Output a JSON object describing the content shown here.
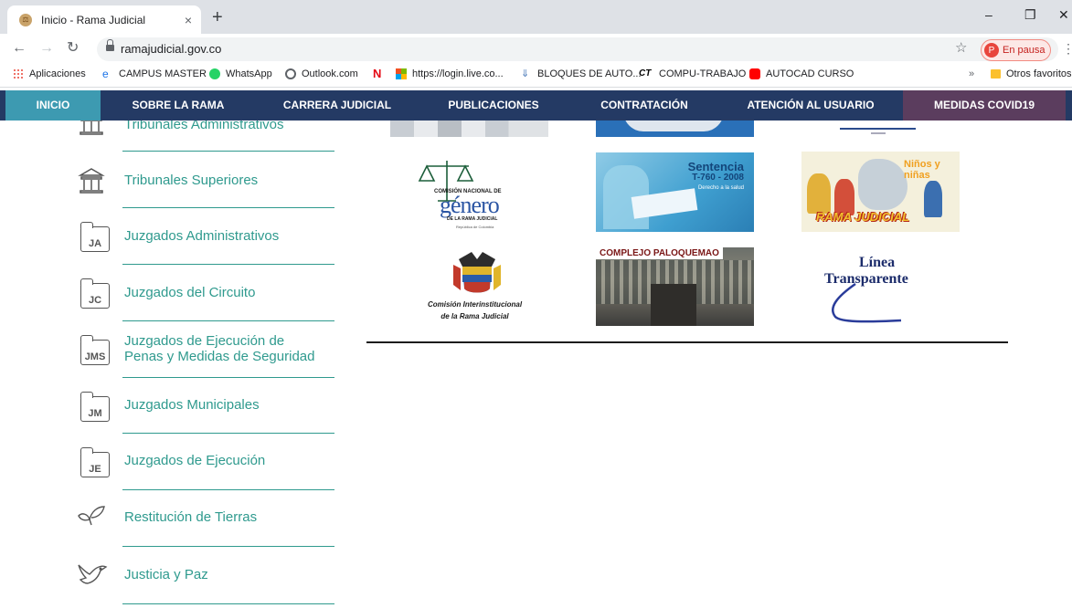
{
  "browser": {
    "tab_title": "Inicio - Rama Judicial",
    "tab_close": "×",
    "new_tab": "+",
    "url": "ramajudicial.gov.co",
    "profile_initial": "P",
    "profile_label": "En pausa",
    "window_controls": [
      "–",
      "❐",
      "✕"
    ]
  },
  "bookmarks": [
    {
      "label": "Aplicaciones",
      "icon": "apps-grid-icon"
    },
    {
      "label": "CAMPUS MASTER",
      "icon": "edge-icon"
    },
    {
      "label": "WhatsApp",
      "icon": "whatsapp-icon"
    },
    {
      "label": "Outlook.com",
      "icon": "outlook-icon"
    },
    {
      "label": "",
      "icon": "netflix-icon"
    },
    {
      "label": "https://login.live.co...",
      "icon": "microsoft-icon"
    },
    {
      "label": "BLOQUES DE AUTO...",
      "icon": "bookmark-icon"
    },
    {
      "label": "COMPU-TRABAJO",
      "icon": "ct-icon"
    },
    {
      "label": "AUTOCAD CURSO",
      "icon": "youtube-icon"
    },
    {
      "label": "»",
      "icon": "overflow-icon"
    },
    {
      "label": "Otros favoritos",
      "icon": "folder-icon"
    }
  ],
  "site_nav": {
    "items": [
      "INICIO",
      "SOBRE LA RAMA",
      "CARRERA JUDICIAL",
      "PUBLICACIONES",
      "CONTRATACIÓN",
      "ATENCIÓN AL USUARIO",
      "MEDIDAS COVID19"
    ]
  },
  "sidebar": {
    "items": [
      {
        "label": "Tribunales Administrativos",
        "icon": "building-icon"
      },
      {
        "label": "Tribunales Superiores",
        "icon": "building-icon"
      },
      {
        "label": "Juzgados Administrativos",
        "icon_text": "JA"
      },
      {
        "label": "Juzgados del Circuito",
        "icon_text": "JC"
      },
      {
        "label": "Juzgados de Ejecución de Penas y Medidas de Seguridad",
        "line1": "Juzgados de Ejecución de",
        "line2": "Penas y Medidas de Seguridad",
        "icon_text": "JMS"
      },
      {
        "label": "Juzgados Municipales",
        "icon_text": "JM"
      },
      {
        "label": "Juzgados de Ejecución",
        "icon_text": "JE"
      },
      {
        "label": "Restitución de Tierras",
        "icon": "sprout-icon"
      },
      {
        "label": "Justicia y Paz",
        "icon": "dove-icon"
      }
    ]
  },
  "tiles": {
    "genero": {
      "top": "COMISIÓN NACIONAL DE",
      "main": "género",
      "sub": "DE LA RAMA JUDICIAL",
      "foot": "República de Colombia"
    },
    "sentencia": {
      "title": "Sentencia",
      "sub": "T-760 - 2008",
      "foot": "Derecho a la salud"
    },
    "ninos": {
      "title": "Niños y niñas",
      "banner": "RAMA JUDICIAL"
    },
    "comision": {
      "line1": "Comisión Interinstitucional",
      "line2": "de la Rama Judicial"
    },
    "paloquemao": {
      "title": "COMPLEJO PALOQUEMAO"
    },
    "linea": {
      "line1": "Línea",
      "line2": "Transparente"
    }
  }
}
